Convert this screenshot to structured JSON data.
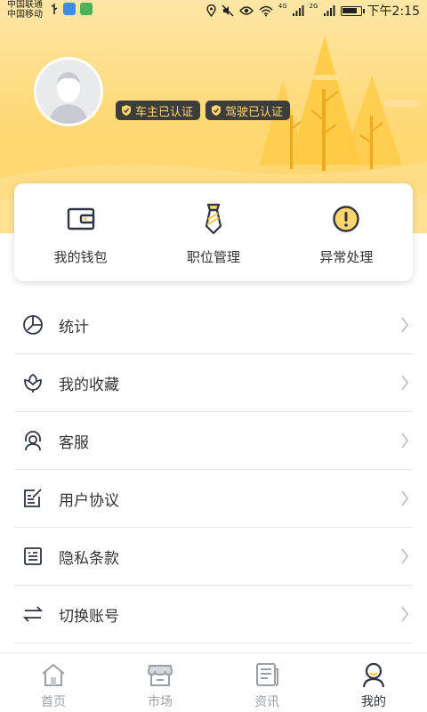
{
  "status_bar": {
    "carrier_1": "中国联通",
    "carrier_2": "中国移动",
    "network_1": "4G",
    "network_2": "2G",
    "time": "下午2:15",
    "icons": [
      "usb-icon",
      "app-shield-icon",
      "app-green-icon",
      "location-icon",
      "mute-icon",
      "eye-icon",
      "wifi-icon",
      "signal-icon",
      "battery-icon"
    ]
  },
  "profile": {
    "badges": [
      {
        "label": "车主已认证",
        "icon": "shield-check-icon"
      },
      {
        "label": "驾驶已认证",
        "icon": "shield-check-icon"
      }
    ]
  },
  "quick_actions": [
    {
      "label": "我的钱包",
      "icon": "wallet-icon"
    },
    {
      "label": "职位管理",
      "icon": "tie-icon"
    },
    {
      "label": "异常处理",
      "icon": "alert-icon"
    }
  ],
  "menu": [
    {
      "label": "统计",
      "icon": "pie-chart-icon"
    },
    {
      "label": "我的收藏",
      "icon": "lotus-icon"
    },
    {
      "label": "客服",
      "icon": "headset-icon"
    },
    {
      "label": "用户协议",
      "icon": "edit-doc-icon"
    },
    {
      "label": "隐私条款",
      "icon": "list-doc-icon"
    },
    {
      "label": "切换账号",
      "icon": "switch-icon"
    }
  ],
  "bottom_nav": [
    {
      "label": "首页",
      "icon": "home-icon",
      "active": false
    },
    {
      "label": "市场",
      "icon": "store-icon",
      "active": false
    },
    {
      "label": "资讯",
      "icon": "news-icon",
      "active": false
    },
    {
      "label": "我的",
      "icon": "user-icon",
      "active": true
    }
  ],
  "colors": {
    "accent": "#ffd66e",
    "badge_bg": "#3d3d3d",
    "text": "#333333",
    "nav_inactive": "#9aa0a6",
    "nav_active": "#2f3440"
  }
}
